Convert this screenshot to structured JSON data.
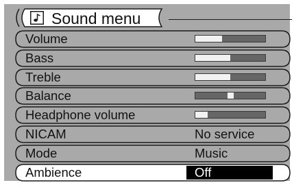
{
  "menu": {
    "title": "Sound menu",
    "title_icon": "music-note-icon",
    "items": [
      {
        "label": "Volume",
        "type": "slider",
        "level": 0.38
      },
      {
        "label": "Bass",
        "type": "slider",
        "level": 0.5
      },
      {
        "label": "Treble",
        "type": "slider",
        "level": 0.5
      },
      {
        "label": "Balance",
        "type": "balance",
        "level": 0.5
      },
      {
        "label": "Headphone volume",
        "type": "slider",
        "level": 0.18
      },
      {
        "label": "NICAM",
        "type": "value",
        "value": "No service"
      },
      {
        "label": "Mode",
        "type": "value",
        "value": "Music"
      },
      {
        "label": "Ambience",
        "type": "value",
        "value": "Off",
        "selected": true
      }
    ]
  },
  "colors": {
    "panel": "#a9a9a9",
    "selected_row": "#ffffff",
    "slider_track": "#666666",
    "slider_fill": "#f2f2f2",
    "value_highlight": "#000000"
  }
}
